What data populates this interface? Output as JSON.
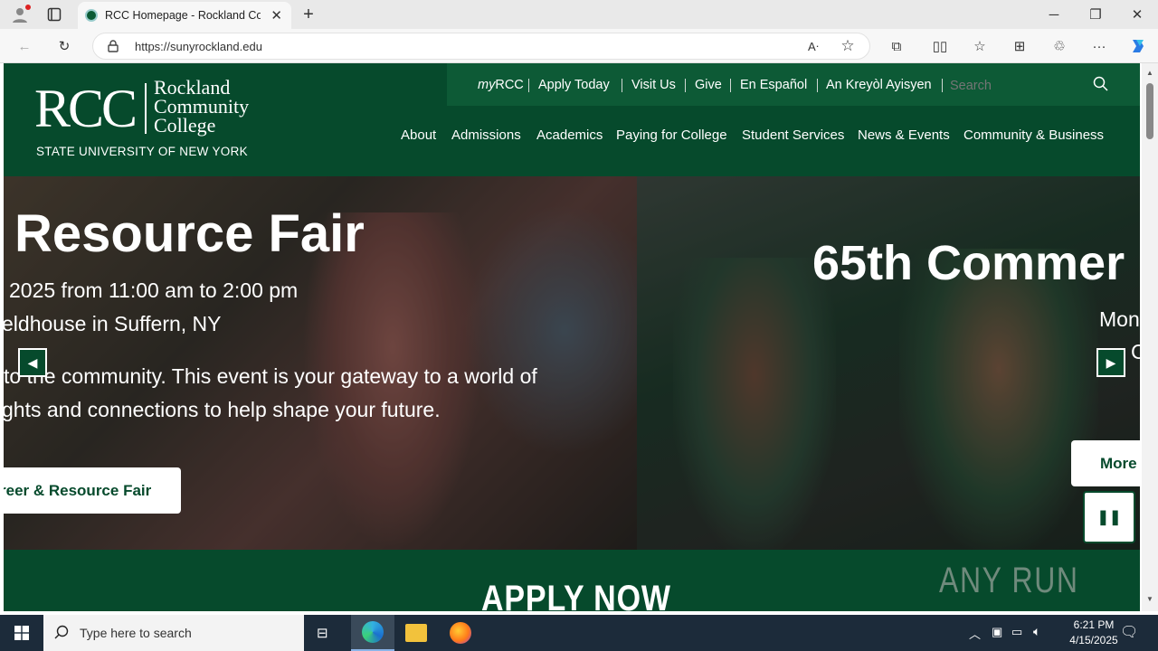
{
  "browser": {
    "tab_title": "RCC Homepage - Rockland Com",
    "url": "https://sunyrockland.edu"
  },
  "header": {
    "logo_rcc": "RCC",
    "logo_line1": "Rockland",
    "logo_line2": "Community",
    "logo_line3": "College",
    "logo_suny": "STATE UNIVERSITY OF NEW YORK",
    "utility": {
      "myrcc_prefix": "my",
      "myrcc_suffix": "RCC",
      "apply": "Apply Today",
      "visit": "Visit Us",
      "give": "Give",
      "espanol": "En Español",
      "kreyol": "An Kreyòl Ayisyen",
      "search_placeholder": "Search"
    },
    "nav": [
      "About",
      "Admissions",
      "Academics",
      "Paying for College",
      "Student Services",
      "News & Events",
      "Community & Business"
    ]
  },
  "hero": {
    "slide1": {
      "title": "Resource Fair",
      "line1": "2025 from 11:00 am to 2:00 pm",
      "line2": "eldhouse in Suffern, NY",
      "line3": "to the community. This event is your gateway to a world of",
      "line4": "ghts and connections to help shape your future.",
      "button": "reer & Resource Fair"
    },
    "slide2": {
      "title": "65th Commer",
      "line1": "Mon",
      "line2": "C",
      "button": "More"
    }
  },
  "apply_banner": "APPLY NOW",
  "watermark": "ANY RUN",
  "taskbar": {
    "search_placeholder": "Type here to search",
    "time": "6:21 PM",
    "date": "4/15/2025"
  }
}
